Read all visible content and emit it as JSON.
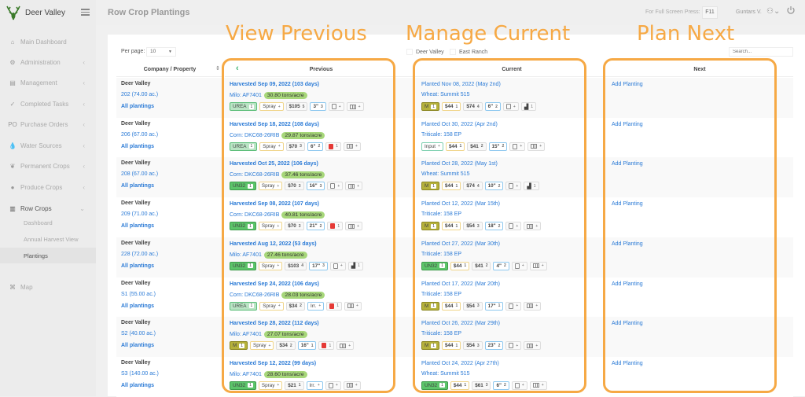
{
  "app": {
    "brand": "Deer Valley",
    "page_title": "Row Crop Plantings",
    "fullscreen_text": "For Full Screen Press:",
    "fullscreen_key": "F11",
    "user": "Guntars V."
  },
  "sidebar": {
    "items": [
      {
        "label": "Main Dashboard",
        "icon": "dashboard-icon",
        "glyph": "⌂",
        "chevron": ""
      },
      {
        "label": "Administration",
        "icon": "gears-icon",
        "glyph": "⚙",
        "chevron": "‹"
      },
      {
        "label": "Management",
        "icon": "management-icon",
        "glyph": "▤",
        "chevron": "‹"
      },
      {
        "label": "Completed Tasks",
        "icon": "tasks-icon",
        "glyph": "✓",
        "chevron": "‹"
      },
      {
        "label": "Purchase Orders",
        "icon": "po-icon",
        "glyph": "PO",
        "chevron": "‹"
      },
      {
        "label": "Water Sources",
        "icon": "water-icon",
        "glyph": "💧",
        "chevron": "‹"
      },
      {
        "label": "Permanent Crops",
        "icon": "leaf-icon",
        "glyph": "❦",
        "chevron": "‹"
      },
      {
        "label": "Produce Crops",
        "icon": "produce-icon",
        "glyph": "●",
        "chevron": "‹"
      },
      {
        "label": "Row Crops",
        "icon": "tractor-icon",
        "glyph": "▥",
        "chevron": "⌄"
      }
    ],
    "sub_items": [
      {
        "label": "Dashboard"
      },
      {
        "label": "Annual Harvest View"
      },
      {
        "label": "Plantings"
      }
    ],
    "map": {
      "label": "Map",
      "glyph": "⌘"
    }
  },
  "toolbar": {
    "per_page_label": "Per page:",
    "per_page_value": "10",
    "filters": [
      "Deer Valley",
      "East Ranch"
    ],
    "search_placeholder": "Search..."
  },
  "table": {
    "headers": {
      "property": "Company / Property",
      "previous": "Previous",
      "current": "Current",
      "next": "Next"
    },
    "rows": [
      {
        "company": "Deer Valley",
        "field": "202 (74.00 ac.)",
        "all": "All plantings",
        "prev": {
          "title": "Harvested Sep 09, 2022 (103 days)",
          "crop": "Milo: AF7401",
          "yield": "30.80 tons/acre",
          "chips": [
            {
              "t": "fert-urea",
              "l": "UREA",
              "n": "1"
            },
            {
              "t": "spray",
              "l": "Spray",
              "n": "+"
            },
            {
              "t": "cost",
              "l": "$105",
              "n": "5"
            },
            {
              "t": "water",
              "l": "3\"",
              "n": "3"
            },
            {
              "t": "doc",
              "l": "",
              "n": "+"
            },
            {
              "t": "map",
              "l": "",
              "n": "+"
            }
          ]
        },
        "curr": {
          "title": "Planted Nov 08, 2022 (May 2nd)",
          "crop": "Wheat: Summit 515",
          "chips": [
            {
              "t": "fert-m",
              "l": "M",
              "n": "1"
            },
            {
              "t": "seed",
              "l": "$44",
              "n": "1"
            },
            {
              "t": "cost",
              "l": "$74",
              "n": "4"
            },
            {
              "t": "water",
              "l": "6\"",
              "n": "2"
            },
            {
              "t": "doc",
              "l": "",
              "n": "+"
            },
            {
              "t": "eq",
              "l": "",
              "n": "1"
            }
          ]
        },
        "next": "Add Planting"
      },
      {
        "company": "Deer Valley",
        "field": "206 (67.00 ac.)",
        "all": "All plantings",
        "prev": {
          "title": "Harvested Sep 18, 2022 (108 days)",
          "crop": "Corn: DKC68-26RIB",
          "yield": "29.87 tons/acre",
          "chips": [
            {
              "t": "fert-urea",
              "l": "UREA",
              "n": "1"
            },
            {
              "t": "spray",
              "l": "Spray",
              "n": "+"
            },
            {
              "t": "cost",
              "l": "$70",
              "n": "3"
            },
            {
              "t": "water",
              "l": "6\"",
              "n": "2"
            },
            {
              "t": "doc-red",
              "l": "",
              "n": "1"
            },
            {
              "t": "map",
              "l": "",
              "n": "+"
            }
          ]
        },
        "curr": {
          "title": "Planted Oct 30, 2022 (Apr 2nd)",
          "crop": "Triticale: 158 EP",
          "chips": [
            {
              "t": "input",
              "l": "Input",
              "n": "+"
            },
            {
              "t": "seed",
              "l": "$44",
              "n": "1"
            },
            {
              "t": "cost",
              "l": "$41",
              "n": "2"
            },
            {
              "t": "water",
              "l": "15\"",
              "n": "2"
            },
            {
              "t": "doc",
              "l": "",
              "n": "+"
            },
            {
              "t": "map",
              "l": "",
              "n": "+"
            }
          ]
        },
        "next": "Add Planting"
      },
      {
        "company": "Deer Valley",
        "field": "208 (67.00 ac.)",
        "all": "All plantings",
        "prev": {
          "title": "Harvested Oct 25, 2022 (106 days)",
          "crop": "Corn: DKC68-26RIB",
          "yield": "37.46 tons/acre",
          "chips": [
            {
              "t": "fert-un32",
              "l": "UN32",
              "n": "1"
            },
            {
              "t": "spray",
              "l": "Spray",
              "n": "+"
            },
            {
              "t": "cost",
              "l": "$70",
              "n": "3"
            },
            {
              "t": "water",
              "l": "16\"",
              "n": "3"
            },
            {
              "t": "doc",
              "l": "",
              "n": "+"
            },
            {
              "t": "map",
              "l": "",
              "n": "+"
            }
          ]
        },
        "curr": {
          "title": "Planted Oct 28, 2022 (May 1st)",
          "crop": "Wheat: Summit 515",
          "chips": [
            {
              "t": "fert-m",
              "l": "M",
              "n": "1"
            },
            {
              "t": "seed",
              "l": "$44",
              "n": "1"
            },
            {
              "t": "cost",
              "l": "$74",
              "n": "4"
            },
            {
              "t": "water",
              "l": "10\"",
              "n": "2"
            },
            {
              "t": "doc",
              "l": "",
              "n": "+"
            },
            {
              "t": "eq",
              "l": "",
              "n": "1"
            }
          ]
        },
        "next": "Add Planting"
      },
      {
        "company": "Deer Valley",
        "field": "209 (71.00 ac.)",
        "all": "All plantings",
        "prev": {
          "title": "Harvested Sep 08, 2022 (107 days)",
          "crop": "Corn: DKC68-26RIB",
          "yield": "40.81 tons/acre",
          "chips": [
            {
              "t": "fert-un32",
              "l": "UN32",
              "n": "1"
            },
            {
              "t": "spray",
              "l": "Spray",
              "n": "+"
            },
            {
              "t": "cost",
              "l": "$70",
              "n": "3"
            },
            {
              "t": "water",
              "l": "21\"",
              "n": "2"
            },
            {
              "t": "doc-red",
              "l": "",
              "n": "1"
            },
            {
              "t": "map",
              "l": "",
              "n": "+"
            }
          ]
        },
        "curr": {
          "title": "Planted Oct 12, 2022 (Mar 15th)",
          "crop": "Triticale: 158 EP",
          "chips": [
            {
              "t": "fert-m",
              "l": "M",
              "n": "1"
            },
            {
              "t": "seed",
              "l": "$44",
              "n": "1"
            },
            {
              "t": "cost",
              "l": "$54",
              "n": "3"
            },
            {
              "t": "water",
              "l": "18\"",
              "n": "2"
            },
            {
              "t": "doc",
              "l": "",
              "n": "+"
            },
            {
              "t": "map",
              "l": "",
              "n": "+"
            }
          ]
        },
        "next": "Add Planting"
      },
      {
        "company": "Deer Valley",
        "field": "228 (72.00 ac.)",
        "all": "All plantings",
        "prev": {
          "title": "Harvested Aug 12, 2022 (53 days)",
          "crop": "Milo: AF7401",
          "yield": "27.46 tons/acre",
          "chips": [
            {
              "t": "fert-un32",
              "l": "UN32",
              "n": "1"
            },
            {
              "t": "spray",
              "l": "Spray",
              "n": "+"
            },
            {
              "t": "cost",
              "l": "$103",
              "n": "4"
            },
            {
              "t": "water",
              "l": "17\"",
              "n": "3"
            },
            {
              "t": "doc",
              "l": "",
              "n": "+"
            },
            {
              "t": "eq",
              "l": "",
              "n": "1"
            }
          ]
        },
        "curr": {
          "title": "Planted Oct 27, 2022 (Mar 30th)",
          "crop": "Triticale: 158 EP",
          "chips": [
            {
              "t": "fert-un32",
              "l": "UN32",
              "n": "1"
            },
            {
              "t": "seed",
              "l": "$44",
              "n": "1"
            },
            {
              "t": "cost",
              "l": "$41",
              "n": "2"
            },
            {
              "t": "water",
              "l": "4\"",
              "n": "2"
            },
            {
              "t": "doc",
              "l": "",
              "n": "+"
            },
            {
              "t": "map",
              "l": "",
              "n": "+"
            }
          ]
        },
        "next": "Add Planting"
      },
      {
        "company": "Deer Valley",
        "field": "S1 (55.00 ac.)",
        "all": "All plantings",
        "prev": {
          "title": "Harvested Sep 24, 2022 (106 days)",
          "crop": "Corn: DKC68-26RIB",
          "yield": "28.03 tons/acre",
          "chips": [
            {
              "t": "fert-urea",
              "l": "UREA",
              "n": "1"
            },
            {
              "t": "spray",
              "l": "Spray",
              "n": "+"
            },
            {
              "t": "cost",
              "l": "$34",
              "n": "2"
            },
            {
              "t": "irr",
              "l": "Irr.",
              "n": "+"
            },
            {
              "t": "doc-red",
              "l": "",
              "n": "1"
            },
            {
              "t": "map",
              "l": "",
              "n": "+"
            }
          ]
        },
        "curr": {
          "title": "Planted Oct 17, 2022 (Mar 20th)",
          "crop": "Triticale: 158 EP",
          "chips": [
            {
              "t": "fert-m",
              "l": "M",
              "n": "1"
            },
            {
              "t": "seed",
              "l": "$44",
              "n": "1"
            },
            {
              "t": "cost",
              "l": "$54",
              "n": "3"
            },
            {
              "t": "water",
              "l": "17\"",
              "n": "1"
            },
            {
              "t": "doc",
              "l": "",
              "n": "+"
            },
            {
              "t": "map",
              "l": "",
              "n": "+"
            }
          ]
        },
        "next": "Add Planting"
      },
      {
        "company": "Deer Valley",
        "field": "S2 (40.00 ac.)",
        "all": "All plantings",
        "prev": {
          "title": "Harvested Sep 28, 2022 (112 days)",
          "crop": "Milo: AF7401",
          "yield": "27.07 tons/acre",
          "chips": [
            {
              "t": "fert-m",
              "l": "M",
              "n": "1"
            },
            {
              "t": "spray",
              "l": "Spray",
              "n": "+"
            },
            {
              "t": "cost",
              "l": "$34",
              "n": "2"
            },
            {
              "t": "water",
              "l": "16\"",
              "n": "1"
            },
            {
              "t": "doc-red",
              "l": "",
              "n": "1"
            },
            {
              "t": "map",
              "l": "",
              "n": "+"
            }
          ]
        },
        "curr": {
          "title": "Planted Oct 26, 2022 (Mar 29th)",
          "crop": "Triticale: 158 EP",
          "chips": [
            {
              "t": "fert-m",
              "l": "M",
              "n": "1"
            },
            {
              "t": "seed",
              "l": "$44",
              "n": "1"
            },
            {
              "t": "cost",
              "l": "$54",
              "n": "3"
            },
            {
              "t": "water",
              "l": "23\"",
              "n": "2"
            },
            {
              "t": "doc",
              "l": "",
              "n": "+"
            },
            {
              "t": "map",
              "l": "",
              "n": "+"
            }
          ]
        },
        "next": "Add Planting"
      },
      {
        "company": "Deer Valley",
        "field": "S3 (140.00 ac.)",
        "all": "All plantings",
        "prev": {
          "title": "Harvested Sep 12, 2022 (99 days)",
          "crop": "Milo: AF7401",
          "yield": "28.60 tons/acre",
          "chips": [
            {
              "t": "fert-un32",
              "l": "UN32",
              "n": "1"
            },
            {
              "t": "spray",
              "l": "Spray",
              "n": "+"
            },
            {
              "t": "cost",
              "l": "$21",
              "n": "1"
            },
            {
              "t": "irr",
              "l": "Irr.",
              "n": "+"
            },
            {
              "t": "doc",
              "l": "",
              "n": "+"
            },
            {
              "t": "map",
              "l": "",
              "n": "+"
            }
          ]
        },
        "curr": {
          "title": "Planted Oct 24, 2022 (Apr 27th)",
          "crop": "Wheat: Summit 515",
          "chips": [
            {
              "t": "fert-un32",
              "l": "UN32",
              "n": "1"
            },
            {
              "t": "seed",
              "l": "$44",
              "n": "1"
            },
            {
              "t": "cost",
              "l": "$61",
              "n": "3"
            },
            {
              "t": "water",
              "l": "6\"",
              "n": "2"
            },
            {
              "t": "doc",
              "l": "",
              "n": "+"
            },
            {
              "t": "map",
              "l": "",
              "n": "+"
            }
          ]
        },
        "next": "Add Planting"
      }
    ]
  },
  "annotations": {
    "previous": "View Previous",
    "current": "Manage Current",
    "next": "Plan Next",
    "color": "#f6a945"
  }
}
